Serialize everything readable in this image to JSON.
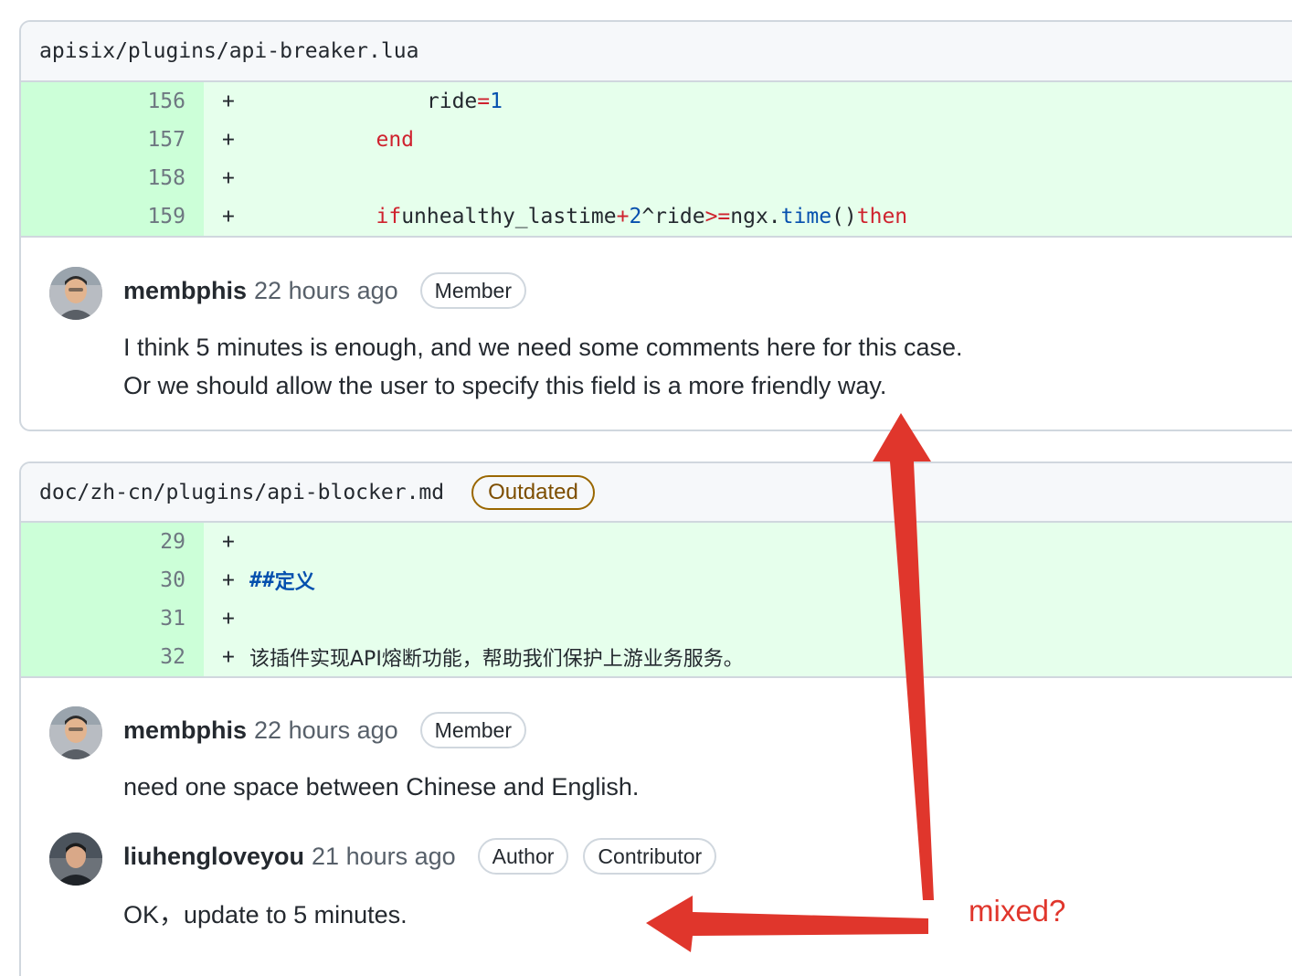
{
  "file1": {
    "path": "apisix/plugins/api-breaker.lua",
    "lines": [
      {
        "num": "156",
        "marker": "+"
      },
      {
        "num": "157",
        "marker": "+"
      },
      {
        "num": "158",
        "marker": "+"
      },
      {
        "num": "159",
        "marker": "+"
      }
    ],
    "code": {
      "l156_ident": "ride",
      "l156_op": "=",
      "l156_num": "1",
      "l157_kw": "end",
      "l159_if": "if",
      "l159_ident": "unhealthy_lastime",
      "l159_plus": "+",
      "l159_two": "2",
      "l159_ride": "^ride",
      "l159_ge": ">=",
      "l159_ngx": "ngx.",
      "l159_time": "time",
      "l159_parens": "()",
      "l159_then": "then"
    },
    "comment": {
      "author": "membphis",
      "time": "22 hours ago",
      "badge": "Member",
      "line1": "I think 5 minutes is enough, and we need some comments here for this case.",
      "line2": "Or we should allow the user to specify this field is a more friendly way."
    }
  },
  "file2": {
    "path": "doc/zh-cn/plugins/api-blocker.md",
    "outdated_label": "Outdated",
    "lines": [
      {
        "num": "29",
        "marker": "+"
      },
      {
        "num": "30",
        "marker": "+"
      },
      {
        "num": "31",
        "marker": "+"
      },
      {
        "num": "32",
        "marker": "+"
      }
    ],
    "code": {
      "l30_hash": "##",
      "l30_text": "定义",
      "l32_text": "该插件实现API熔断功能，帮助我们保护上游业务服务。"
    },
    "comments": [
      {
        "author": "membphis",
        "time": "22 hours ago",
        "badge": "Member",
        "body": "need one space between Chinese and English."
      },
      {
        "author": "liuhengloveyou",
        "time": "21 hours ago",
        "badge_author": "Author",
        "badge_contributor": "Contributor",
        "body": "OK，update to 5 minutes."
      }
    ]
  },
  "annotation": {
    "label": "mixed?",
    "color": "#e0362c"
  }
}
